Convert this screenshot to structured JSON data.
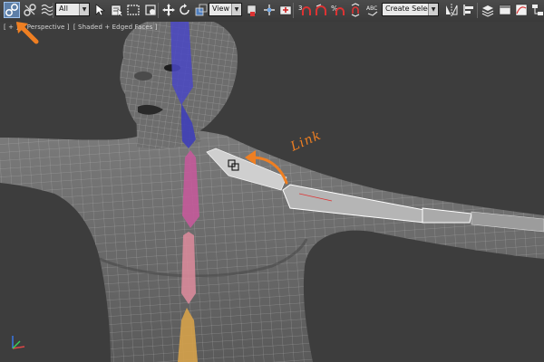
{
  "toolbar": {
    "filter_value": "All",
    "reference_coord_value": "View",
    "named_selection_value": "Create Selection Se",
    "active_tool": "select-and-link"
  },
  "viewport": {
    "label_plus": "[ + ]",
    "label_view": "[ Perspective ]",
    "label_shading": "[ Shaded + Edged Faces ]"
  },
  "annotation": {
    "text": "Link",
    "color": "#ef7f22"
  },
  "colors": {
    "viewport_bg": "#3d3d3d",
    "toolbar_bg": "#444444",
    "active_button": "#5d7fa8",
    "head_bone": "#4a48c4",
    "spine_bone_upper": "#c45a9a",
    "spine_bone_lower": "#d88a9a",
    "pelvis_bone": "#d6a24a",
    "arm_bone": "#bfbfbf"
  }
}
